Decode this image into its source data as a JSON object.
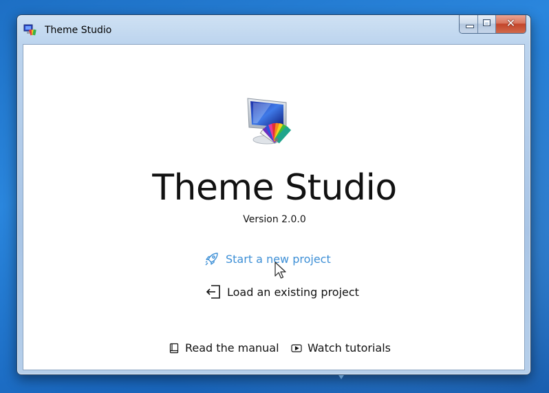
{
  "window": {
    "title": "Theme Studio",
    "caption_buttons": [
      "minimize",
      "maximize",
      "close"
    ]
  },
  "main": {
    "logo_icon": "monitor-with-palette-icon",
    "app_name": "Theme Studio",
    "version": "Version 2.0.0",
    "actions": [
      {
        "label": "Start a new project",
        "icon": "rocket-icon",
        "hovered": true
      },
      {
        "label": "Load an existing project",
        "icon": "enter-arrow-icon",
        "hovered": false
      }
    ]
  },
  "footer": {
    "links": [
      {
        "label": "Read the manual",
        "icon": "book-icon"
      },
      {
        "label": "Watch tutorials",
        "icon": "play-icon"
      }
    ]
  },
  "colors": {
    "link_hover": "#3d8fd6",
    "desktop": "#1d6fc4"
  }
}
